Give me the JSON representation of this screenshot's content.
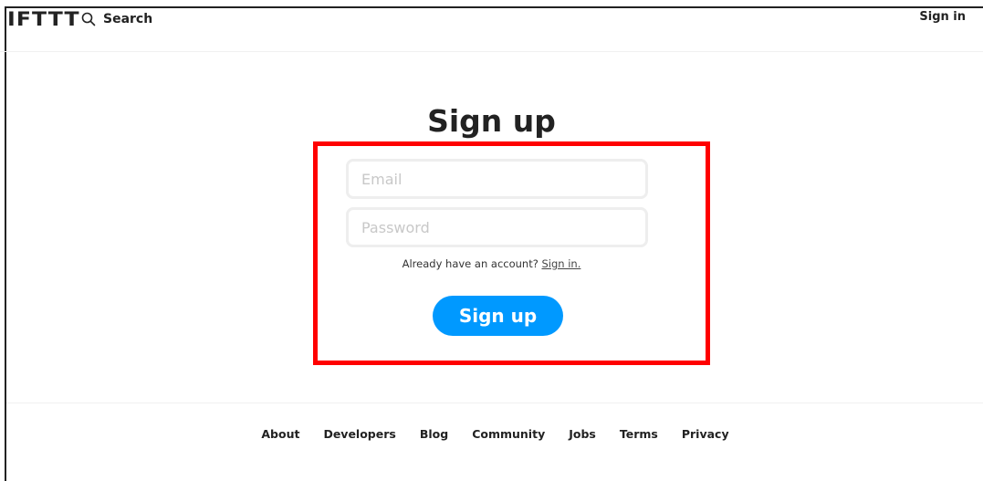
{
  "header": {
    "logo": "IFTTT",
    "search_label": "Search",
    "search_icon": "search-icon",
    "signin_label": "Sign in"
  },
  "main": {
    "title": "Sign up",
    "email_placeholder": "Email",
    "email_value": "",
    "password_placeholder": "Password",
    "password_value": "",
    "account_prompt": "Already have an account?",
    "account_link": "Sign in.",
    "submit_label": "Sign up"
  },
  "footer": {
    "links": [
      "About",
      "Developers",
      "Blog",
      "Community",
      "Jobs",
      "Terms",
      "Privacy"
    ]
  },
  "colors": {
    "accent": "#0099ff",
    "highlight": "#ff0000",
    "text": "#222222",
    "field_border": "#eeeeee"
  }
}
